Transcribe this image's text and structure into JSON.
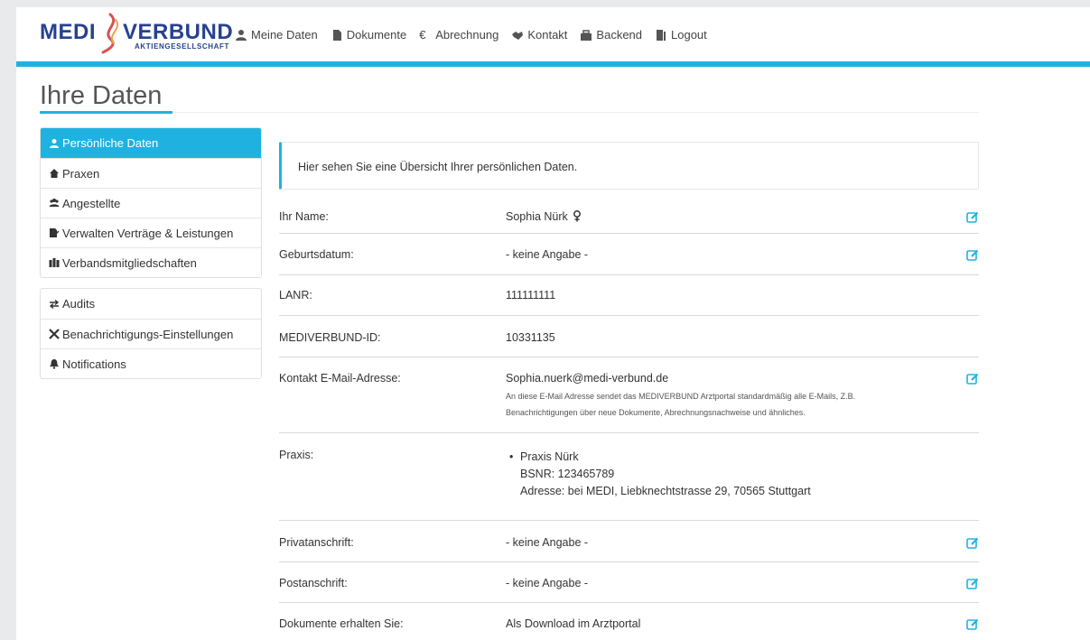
{
  "brand": {
    "word1": "MEDI",
    "word2": "VERBUND",
    "sub": "AKTIENGESELLSCHAFT"
  },
  "nav": [
    {
      "label": "Meine Daten",
      "icon": "user-icon"
    },
    {
      "label": "Dokumente",
      "icon": "file-icon"
    },
    {
      "label": "Abrechnung",
      "icon": "euro-icon"
    },
    {
      "label": "Kontakt",
      "icon": "handshake-icon"
    },
    {
      "label": "Backend",
      "icon": "toolbox-icon"
    },
    {
      "label": "Logout",
      "icon": "door-open-icon"
    }
  ],
  "page_title": "Ihre Daten",
  "sidebar": {
    "group1": [
      {
        "label": "Persönliche Daten",
        "icon": "user-icon",
        "active": true
      },
      {
        "label": "Praxen",
        "icon": "house-icon"
      },
      {
        "label": "Angestellte",
        "icon": "users-icon"
      },
      {
        "label": "Verwalten Verträge & Leistungen",
        "icon": "file-signature-icon"
      },
      {
        "label": "Verbandsmitgliedschaften",
        "icon": "building-icon"
      }
    ],
    "group2": [
      {
        "label": "Audits",
        "icon": "exchange-icon"
      },
      {
        "label": "Benachrichtigungs-Einstellungen",
        "icon": "tools-icon"
      },
      {
        "label": "Notifications",
        "icon": "bell-icon"
      }
    ]
  },
  "info": "Hier sehen Sie eine Übersicht Ihrer persönlichen Daten.",
  "rows": {
    "name": {
      "label": "Ihr Name:",
      "value": "Sophia Nürk",
      "gender_icon": "female-icon"
    },
    "birth": {
      "label": "Geburtsdatum:",
      "value": "- keine Angabe -"
    },
    "lanr": {
      "label": "LANR:",
      "value": "111111111"
    },
    "mvid": {
      "label": "MEDIVERBUND-ID:",
      "value": "10331135"
    },
    "email": {
      "label": "Kontakt E-Mail-Adresse:",
      "value": "Sophia.nuerk@medi-verbund.de",
      "note1": "An diese E-Mail Adresse sendet das MEDIVERBUND Arztportal standardmäßig alle E-Mails, Z.B.",
      "note2": "Benachrichtigungen über neue Dokumente, Abrechnungsnachweise und ähnliches."
    },
    "praxis": {
      "label": "Praxis:",
      "name": "Praxis Nürk",
      "bsnr": "BSNR: 123465789",
      "address": "Adresse: bei MEDI, Liebknechtstrasse 29, 70565 Stuttgart"
    },
    "private": {
      "label": "Privatanschrift:",
      "value": "- keine Angabe -"
    },
    "postal": {
      "label": "Postanschrift:",
      "value": "- keine Angabe -"
    },
    "docs": {
      "label": "Dokumente erhalten Sie:",
      "value": "Als Download im Arztportal"
    }
  },
  "colors": {
    "accent": "#1fb2e1",
    "brand": "#27418f",
    "brand_flame": "#d9534f"
  }
}
